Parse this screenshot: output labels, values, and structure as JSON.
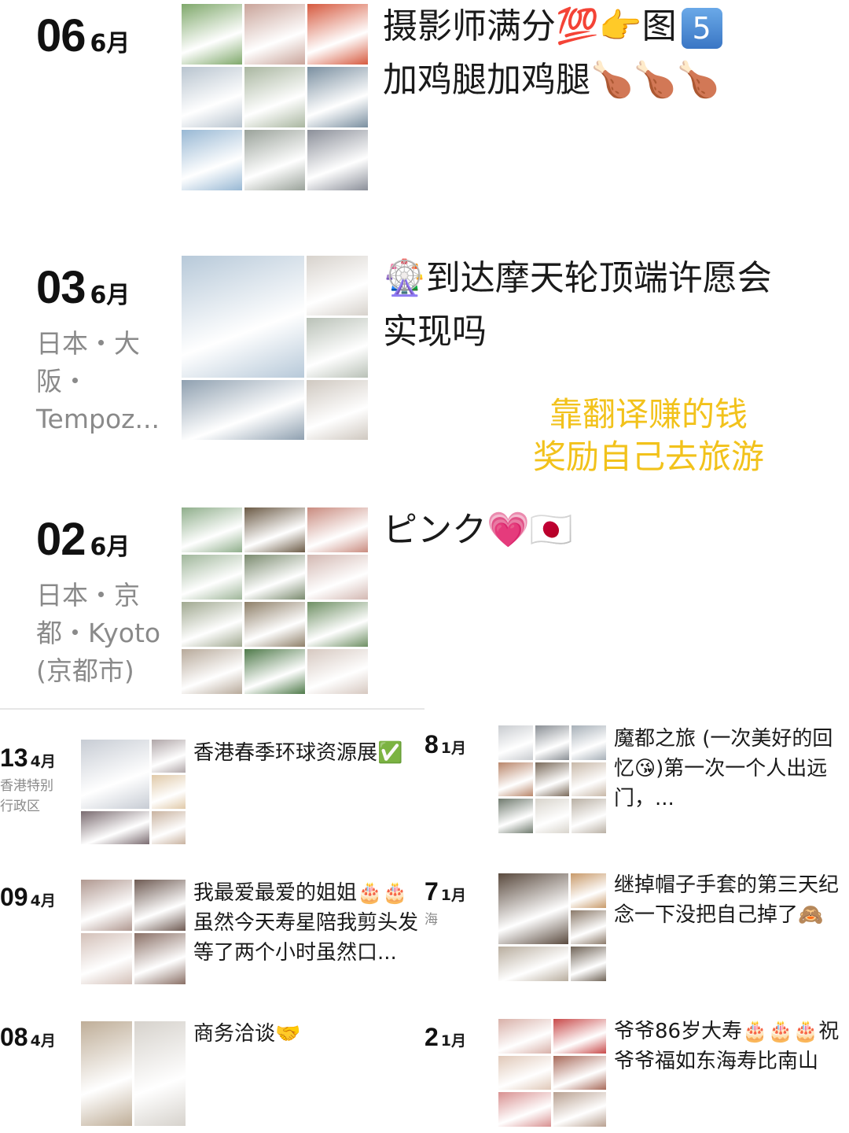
{
  "posts": [
    {
      "day": "06",
      "month": "6月",
      "location": "",
      "caption_line1": "摄影师满分💯👉图",
      "caption_badge": "5",
      "caption_line2": "加鸡腿加鸡腿🍗🍗🍗",
      "colors": [
        "#7fa86b",
        "#c9a49a",
        "#d65a3f",
        "#b8c4cf",
        "#a9b6a0",
        "#7a8fa0",
        "#98b8d4",
        "#9aa29a",
        "#8b8f99",
        "#cfd8e0",
        "#6f8b68",
        "#a0a7ae",
        "#8ca0b8",
        "#c6ccd4",
        "#e1e5ea"
      ]
    },
    {
      "day": "03",
      "month": "6月",
      "location": "日本・大阪・Tempoz...",
      "caption": "🎡到达摩天轮顶端许愿会实现吗",
      "colors": [
        "#b7c9d9",
        "#d7d2cc",
        "#b9c1b7",
        "#8fa0b0",
        "#cfc8c0",
        "#a7b3bc",
        "#c2c6c0"
      ]
    },
    {
      "day": "02",
      "month": "6月",
      "location": "日本・京都・Kyoto (京都市)",
      "caption": "ピンク💗🇯🇵",
      "colors": [
        "#8fae8b",
        "#6b5a45",
        "#c98b7f",
        "#9fb69a",
        "#7a8a6e",
        "#d3b8b2",
        "#a0a890",
        "#8e7f68",
        "#6e8f63",
        "#b7a99a",
        "#4f7a4a",
        "#d6c8c0"
      ]
    }
  ],
  "overlay_text": [
    "靠翻译赚的钱",
    "奖励自己去旅游"
  ],
  "small_posts": [
    {
      "day": "13",
      "month": "4月",
      "location": "香港特别行政区",
      "caption": "香港春季环球资源展✅",
      "colors": [
        "#c7ccd4",
        "#b0a6a8",
        "#e0c9a8",
        "#7a6b70",
        "#c9b3a0",
        "#d4c4b8"
      ]
    },
    {
      "day": "09",
      "month": "4月",
      "location": "",
      "caption": "我最爱最爱的姐姐🎂🎂虽然今天寿星陪我剪头发等了两个小时虽然口...",
      "colors": [
        "#b09890",
        "#6e5a52",
        "#d3c0b8",
        "#8a7066"
      ]
    },
    {
      "day": "08",
      "month": "4月",
      "location": "",
      "caption": "商务洽谈🤝",
      "colors": [
        "#bfae98",
        "#d6d2cc"
      ]
    },
    {
      "day": "8",
      "month": "1月",
      "location": "",
      "caption": "魔都之旅 (一次美好的回忆😘)第一次一个人出远门，...",
      "colors": [
        "#c9ccd0",
        "#8a8f95",
        "#a7b0b8",
        "#b9866a",
        "#7a6a5a",
        "#c8b8a8",
        "#6f7a6e",
        "#d8d4cc"
      ]
    },
    {
      "day": "7",
      "month": "1月",
      "location": "海",
      "caption": "继掉帽子手套的第三天纪念一下没把自己掉了🙈",
      "colors": [
        "#5a4a3e",
        "#c89a6a",
        "#8b7a6a",
        "#b8ad9e",
        "#6f6356",
        "#c9b9a2"
      ]
    },
    {
      "day": "2",
      "month": "1月",
      "location": "",
      "caption": "爷爷86岁大寿🎂🎂🎂祝爷爷福如东海寿比南山",
      "colors": [
        "#d8b0a8",
        "#c84a4a",
        "#e0c8b8",
        "#a86a5a",
        "#d89090",
        "#b8a090"
      ]
    }
  ]
}
